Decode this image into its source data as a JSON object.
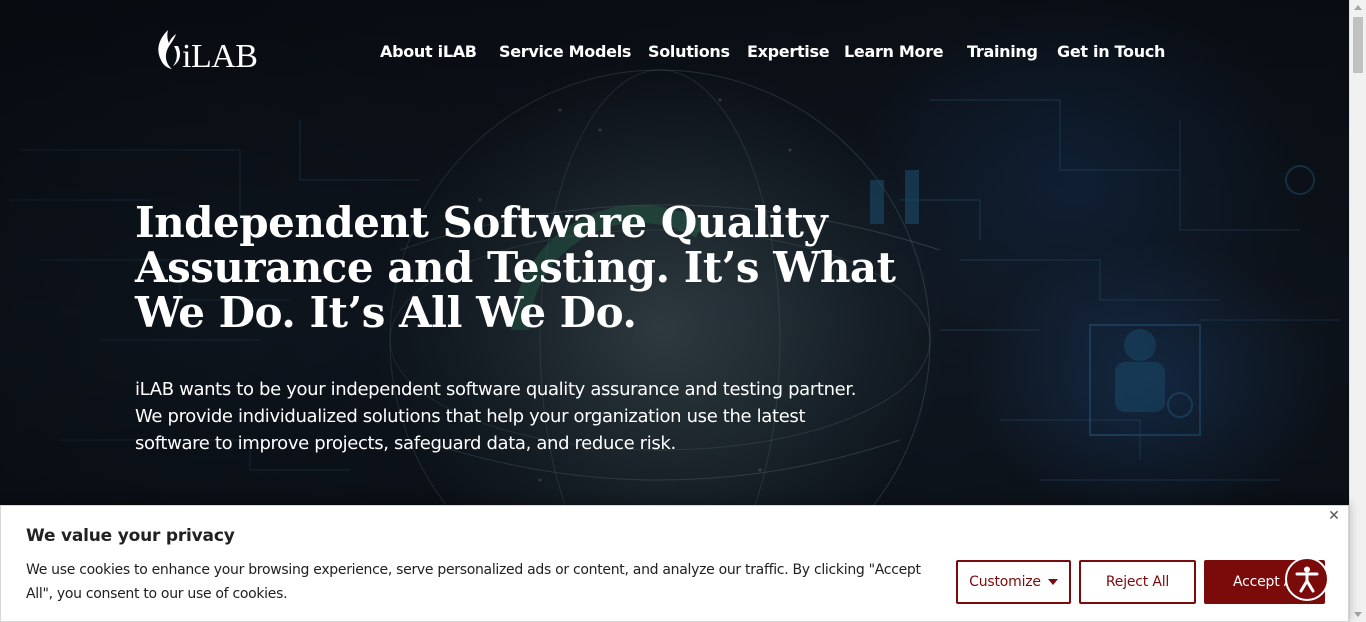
{
  "header": {
    "logo_text": "iLAB",
    "nav": [
      {
        "label": "About iLAB"
      },
      {
        "label": "Service Models"
      },
      {
        "label": "Solutions"
      },
      {
        "label": "Expertise"
      },
      {
        "label": "Learn More"
      },
      {
        "label": "Training"
      },
      {
        "label": "Get in Touch"
      }
    ]
  },
  "hero": {
    "headline": "Independent Software Quality Assurance and Testing. It’s What We Do. It’s All We Do.",
    "intro": "iLAB wants to be your independent software quality assurance and testing partner. We provide individualized solutions that help your organization use the latest software to improve projects, safeguard data, and reduce risk."
  },
  "cookie_banner": {
    "title": "We value your privacy",
    "text": "We use cookies to enhance your browsing experience, serve personalized ads or content, and analyze our traffic. By clicking \"Accept All\", you consent to our use of cookies.",
    "customize_label": "Customize",
    "reject_label": "Reject All",
    "accept_label": "Accept All",
    "close_glyph": "✕"
  },
  "colors": {
    "accent": "#7b0a0a",
    "hero_text": "#ffffff",
    "banner_bg": "#ffffff"
  },
  "icons": {
    "logo": "ilab-flame-logo-icon",
    "close": "close-icon",
    "caret": "caret-down-icon",
    "accessibility": "accessibility-person-icon"
  }
}
